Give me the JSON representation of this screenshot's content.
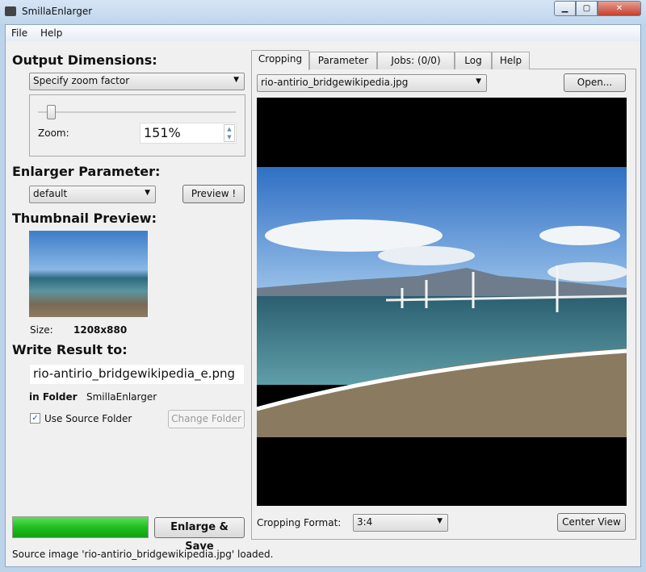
{
  "window": {
    "title": "SmillaEnlarger",
    "minimize": "▁",
    "maximize": "▢",
    "close": "✕"
  },
  "menu": [
    "File",
    "Help"
  ],
  "output": {
    "heading": "Output Dimensions:",
    "mode": "Specify zoom factor",
    "zoom_label": "Zoom:",
    "zoom_value": "151%",
    "slider_fraction": 0.08
  },
  "enlarger": {
    "heading": "Enlarger Parameter:",
    "preset": "default",
    "preview_button": "Preview !"
  },
  "thumbnail": {
    "heading": "Thumbnail Preview:",
    "size_label": "Size:",
    "size_value": "1208x880"
  },
  "write": {
    "heading": "Write Result to:",
    "filename": "rio-antirio_bridgewikipedia_e.png",
    "folder_label": "in Folder",
    "folder_value": "SmillaEnlarger",
    "use_source_label": "Use Source Folder",
    "use_source_checked": true,
    "change_folder": "Change Folder"
  },
  "progress": {
    "percent": 100,
    "color": "#1fbf1f"
  },
  "enlarge_button": "Enlarge & Save",
  "status": "Source image 'rio-antirio_bridgewikipedia.jpg' loaded.",
  "tabs": [
    "Cropping",
    "Parameter",
    "Jobs: (0/0)",
    "Log",
    "Help"
  ],
  "active_tab": "Cropping",
  "cropping": {
    "source_file": "rio-antirio_bridgewikipedia.jpg",
    "open_button": "Open...",
    "format_label": "Cropping Format:",
    "format_value": "3:4",
    "center_button": "Center View"
  }
}
